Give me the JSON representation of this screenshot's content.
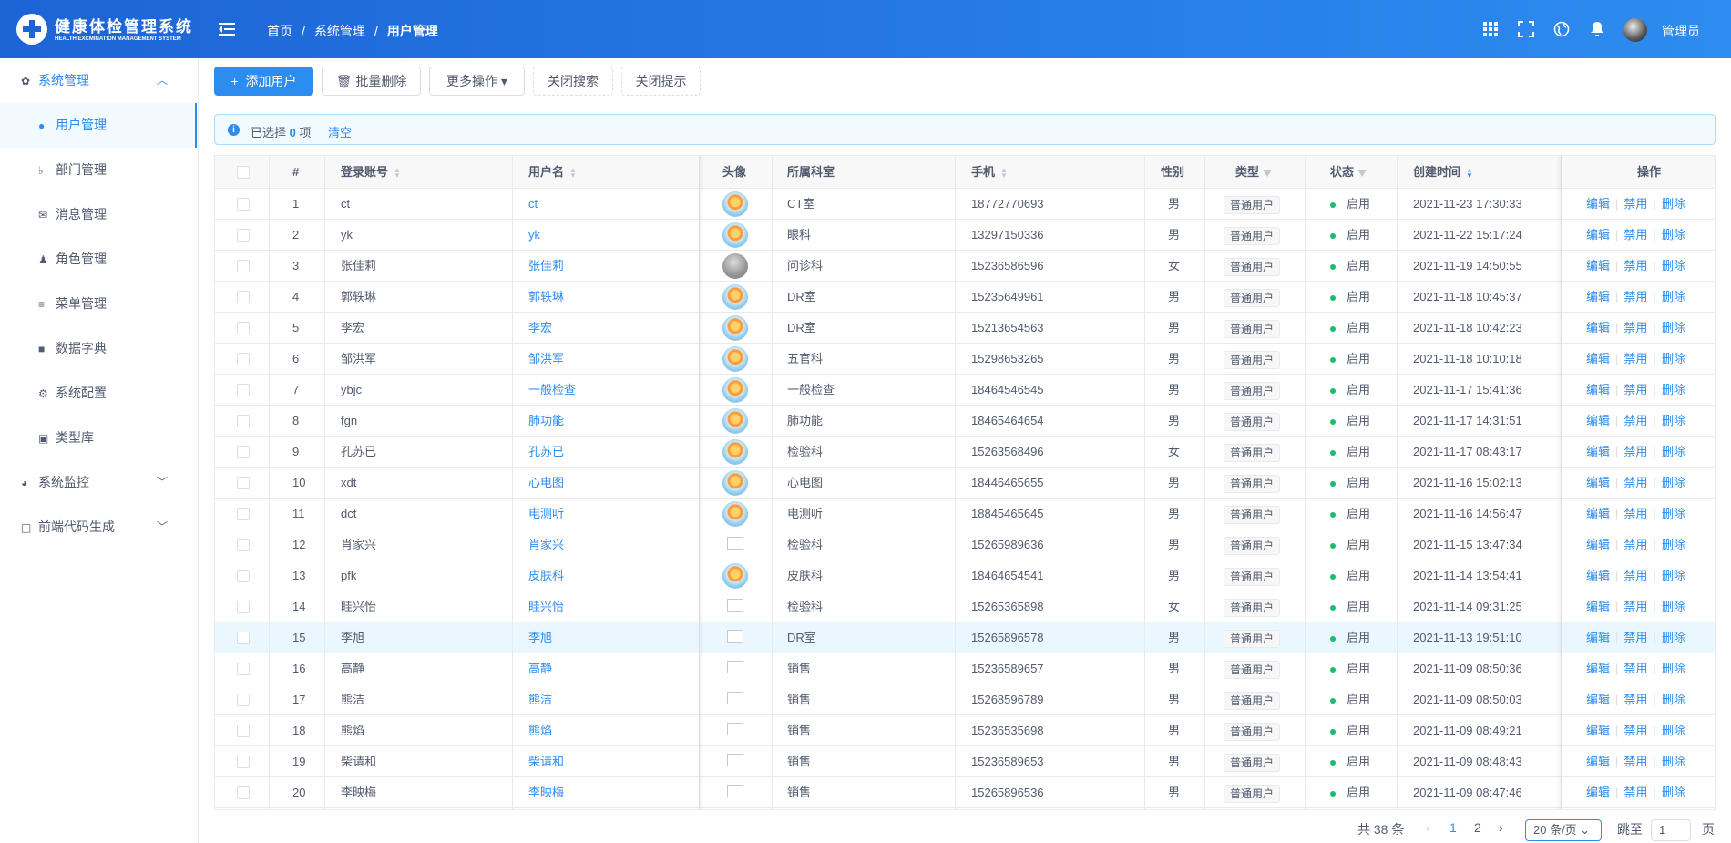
{
  "header": {
    "title": "健康体检管理系统",
    "subtitle": "HEALTH EXCMINATION MANAGEMENT SYSTEM",
    "breadcrumb": [
      "首页",
      "/",
      "系统管理",
      "/",
      "用户管理"
    ],
    "user": "管理员"
  },
  "sidebar": {
    "items": [
      {
        "label": "系统管理",
        "icon": "gear-icon",
        "level": 1,
        "state": "open"
      },
      {
        "label": "用户管理",
        "icon": "user-icon",
        "level": 2,
        "state": "active"
      },
      {
        "label": "部门管理",
        "icon": "department-icon",
        "level": 2
      },
      {
        "label": "消息管理",
        "icon": "mail-icon",
        "level": 2
      },
      {
        "label": "角色管理",
        "icon": "role-icon",
        "level": 2
      },
      {
        "label": "菜单管理",
        "icon": "menu-icon",
        "level": 2
      },
      {
        "label": "数据字典",
        "icon": "book-icon",
        "level": 2
      },
      {
        "label": "系统配置",
        "icon": "settings-icon",
        "level": 2
      },
      {
        "label": "类型库",
        "icon": "box-icon",
        "level": 2
      },
      {
        "label": "系统监控",
        "icon": "monitor-icon",
        "level": 1
      },
      {
        "label": "前端代码生成",
        "icon": "code-icon",
        "level": 1
      }
    ]
  },
  "toolbar": {
    "add": "添加用户",
    "batch_delete": "批量删除",
    "more": "更多操作",
    "close_search": "关闭搜索",
    "close_tip": "关闭提示"
  },
  "alert": {
    "prefix": "已选择",
    "count": "0",
    "suffix": "项",
    "clear": "清空"
  },
  "table": {
    "headers": [
      "#",
      "登录账号",
      "用户名",
      "头像",
      "所属科室",
      "手机",
      "性别",
      "类型",
      "状态",
      "创建时间",
      "操作"
    ],
    "type_value": "普通用户",
    "status_value": "启用",
    "ops": [
      "编辑",
      "禁用",
      "删除"
    ],
    "rows": [
      {
        "no": "1",
        "account": "ct",
        "name": "ct",
        "avatar": "flower",
        "dept": "CT室",
        "phone": "18772770693",
        "sex": "男",
        "created": "2021-11-23 17:30:33"
      },
      {
        "no": "2",
        "account": "yk",
        "name": "yk",
        "avatar": "flower",
        "dept": "眼科",
        "phone": "13297150336",
        "sex": "男",
        "created": "2021-11-22 15:17:24"
      },
      {
        "no": "3",
        "account": "张佳莉",
        "name": "张佳莉",
        "avatar": "photo",
        "dept": "问诊科",
        "phone": "15236586596",
        "sex": "女",
        "created": "2021-11-19 14:50:55"
      },
      {
        "no": "4",
        "account": "郭轶琳",
        "name": "郭轶琳",
        "avatar": "flower",
        "dept": "DR室",
        "phone": "15235649961",
        "sex": "男",
        "created": "2021-11-18 10:45:37"
      },
      {
        "no": "5",
        "account": "李宏",
        "name": "李宏",
        "avatar": "flower",
        "dept": "DR室",
        "phone": "15213654563",
        "sex": "男",
        "created": "2021-11-18 10:42:23"
      },
      {
        "no": "6",
        "account": "邹洪军",
        "name": "邹洪军",
        "avatar": "flower",
        "dept": "五官科",
        "phone": "15298653265",
        "sex": "男",
        "created": "2021-11-18 10:10:18"
      },
      {
        "no": "7",
        "account": "ybjc",
        "name": "一般检查",
        "avatar": "flower",
        "dept": "一般检查",
        "phone": "18464546545",
        "sex": "男",
        "created": "2021-11-17 15:41:36"
      },
      {
        "no": "8",
        "account": "fgn",
        "name": "肺功能",
        "avatar": "flower",
        "dept": "肺功能",
        "phone": "18465464654",
        "sex": "男",
        "created": "2021-11-17 14:31:51"
      },
      {
        "no": "9",
        "account": "孔苏已",
        "name": "孔苏已",
        "avatar": "flower",
        "dept": "检验科",
        "phone": "15263568496",
        "sex": "女",
        "created": "2021-11-17 08:43:17"
      },
      {
        "no": "10",
        "account": "xdt",
        "name": "心电图",
        "avatar": "flower",
        "dept": "心电图",
        "phone": "18446465655",
        "sex": "男",
        "created": "2021-11-16 15:02:13"
      },
      {
        "no": "11",
        "account": "dct",
        "name": "电测听",
        "avatar": "flower",
        "dept": "电测听",
        "phone": "18845465645",
        "sex": "男",
        "created": "2021-11-16 14:56:47"
      },
      {
        "no": "12",
        "account": "肖家兴",
        "name": "肖家兴",
        "avatar": "broken",
        "dept": "检验科",
        "phone": "15265989636",
        "sex": "男",
        "created": "2021-11-15 13:47:34"
      },
      {
        "no": "13",
        "account": "pfk",
        "name": "皮肤科",
        "avatar": "flower",
        "dept": "皮肤科",
        "phone": "18464654541",
        "sex": "男",
        "created": "2021-11-14 13:54:41"
      },
      {
        "no": "14",
        "account": "眭兴怡",
        "name": "眭兴怡",
        "avatar": "broken",
        "dept": "检验科",
        "phone": "15265365898",
        "sex": "女",
        "created": "2021-11-14 09:31:25"
      },
      {
        "no": "15",
        "account": "李旭",
        "name": "李旭",
        "avatar": "broken",
        "dept": "DR室",
        "phone": "15265896578",
        "sex": "男",
        "created": "2021-11-13 19:51:10",
        "highlight": true
      },
      {
        "no": "16",
        "account": "高静",
        "name": "高静",
        "avatar": "broken",
        "dept": "销售",
        "phone": "15236589657",
        "sex": "男",
        "created": "2021-11-09 08:50:36"
      },
      {
        "no": "17",
        "account": "熊洁",
        "name": "熊洁",
        "avatar": "broken",
        "dept": "销售",
        "phone": "15268596789",
        "sex": "男",
        "created": "2021-11-09 08:50:03"
      },
      {
        "no": "18",
        "account": "熊焰",
        "name": "熊焰",
        "avatar": "broken",
        "dept": "销售",
        "phone": "15236535698",
        "sex": "男",
        "created": "2021-11-09 08:49:21"
      },
      {
        "no": "19",
        "account": "柴请和",
        "name": "柴请和",
        "avatar": "broken",
        "dept": "销售",
        "phone": "15236589653",
        "sex": "男",
        "created": "2021-11-09 08:48:43"
      },
      {
        "no": "20",
        "account": "李映梅",
        "name": "李映梅",
        "avatar": "broken",
        "dept": "销售",
        "phone": "15265896536",
        "sex": "男",
        "created": "2021-11-09 08:47:46"
      }
    ]
  },
  "pagination": {
    "total": "共 38 条",
    "pages": [
      "1",
      "2"
    ],
    "current": "1",
    "page_size": "20 条/页",
    "jump_label": "跳至",
    "jump_value": "1",
    "jump_suffix": "页"
  },
  "colors": {
    "primary": "#2d8cf0",
    "header_start": "#1d64d6",
    "success": "#19be6b"
  }
}
